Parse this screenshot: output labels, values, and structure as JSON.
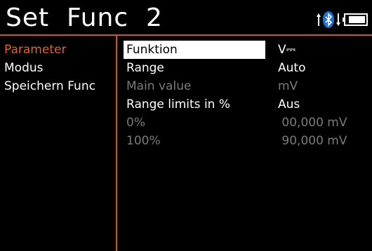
{
  "header": {
    "title": "Set  Func  2",
    "bluetooth_color": "#1e6fd9",
    "icons": [
      "up-arrow-icon",
      "bluetooth-icon",
      "down-arrow-icon",
      "battery-icon"
    ]
  },
  "menu": {
    "items": [
      {
        "label": "Parameter",
        "active": true
      },
      {
        "label": "Modus",
        "active": false
      },
      {
        "label": "Speichern Func",
        "active": false
      }
    ]
  },
  "params": {
    "rows": [
      {
        "label": "Funktion",
        "value": "V⎓",
        "state": "selected"
      },
      {
        "label": "Range",
        "value": "Auto",
        "state": "normal"
      },
      {
        "label": "Main  value",
        "value": "mV",
        "state": "disabled"
      },
      {
        "label": "Range  limits  in  %",
        "value": "Aus",
        "state": "normal"
      },
      {
        "label": "0%",
        "value": " 00,000 mV",
        "state": "disabled"
      },
      {
        "label": "100%",
        "value": " 90,000 mV",
        "state": "disabled"
      }
    ]
  },
  "accent_color": "#d9531e"
}
